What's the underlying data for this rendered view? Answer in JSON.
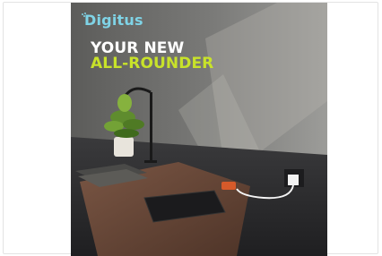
{
  "ad": {
    "brand": "Digitus",
    "headline_line1": "YOUR NEW",
    "headline_line2": "ALL-ROUNDER"
  },
  "colors": {
    "brand": "#7fd3e6",
    "headline_primary": "#ffffff",
    "headline_accent": "#c8e22a",
    "wall": "#6d6d6b",
    "desk": "#2b2b2d",
    "mat": "#6b4a3a"
  }
}
